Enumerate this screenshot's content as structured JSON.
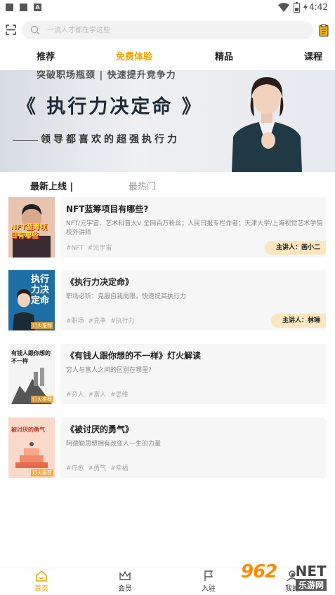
{
  "status_bar": {
    "time": "4:42",
    "a_icon": "A"
  },
  "search": {
    "placeholder": "一流人才都在学这些"
  },
  "tabs": [
    {
      "label": "推荐",
      "active": false
    },
    {
      "label": "免费体验",
      "active": true
    },
    {
      "label": "精品",
      "active": false
    },
    {
      "label": "课程",
      "active": false
    }
  ],
  "banner": {
    "top_text": "突破职场瓶颈 | 快速提升竞争力",
    "title": "《 执行力决定命 》",
    "subtitle": "领导都喜欢的超强执行力",
    "dots": 3,
    "active_dot": 0
  },
  "subtabs": {
    "latest": "最新上线",
    "hot": "最热门"
  },
  "cards": [
    {
      "title": "NFT蓝筹项目有哪些?",
      "desc": "NFT/元宇宙、艺术科普大V 全网百万粉丝；人民日报专栏作者；天津大学/上海视觉艺术学院校外讲师",
      "tags": [
        "#NFT",
        "#元宇宙"
      ],
      "lecturer": "主讲人：画小二",
      "thumb_text": "NFT蓝筹项目有哪些",
      "thumb_caption": ""
    },
    {
      "title": "《执行力决定命》",
      "desc": "职场必听：克服自我局限，快速提高执行力",
      "tags": [
        "#职场",
        "#竞争",
        "#执行力"
      ],
      "lecturer": "主讲人：林琳",
      "thumb_text": "执行力决定命",
      "thumb_caption": "灯火推荐"
    },
    {
      "title": "《有钱人跟你想的不一样》灯火解读",
      "desc": "穷人与富人之间的区别在哪里?",
      "tags": [
        "#穷人",
        "#富人",
        "#思维"
      ],
      "lecturer": "",
      "thumb_text": "有钱人跟你想的不一样",
      "thumb_caption": "灯火推荐"
    },
    {
      "title": "《被讨厌的勇气》",
      "desc": "阿德勒思想拥有改变人一生的力量",
      "tags": [
        "#疗愈",
        "#勇气",
        "#幸福"
      ],
      "lecturer": "",
      "thumb_text": "被讨厌的勇气",
      "thumb_caption": "灯火推荐"
    }
  ],
  "bottom_nav": [
    {
      "label": "首页",
      "icon": "home-icon",
      "active": true
    },
    {
      "label": "会员",
      "icon": "crown-icon",
      "active": false
    },
    {
      "label": "入驻",
      "icon": "flag-icon",
      "active": false
    },
    {
      "label": "我的",
      "icon": "user-icon",
      "active": false
    }
  ],
  "watermark": {
    "logo": "962",
    "suffix": ".NET",
    "cn": "乐游网"
  },
  "colors": {
    "accent": "#f3a300",
    "lecturer_bg": "#fbe6bf"
  }
}
